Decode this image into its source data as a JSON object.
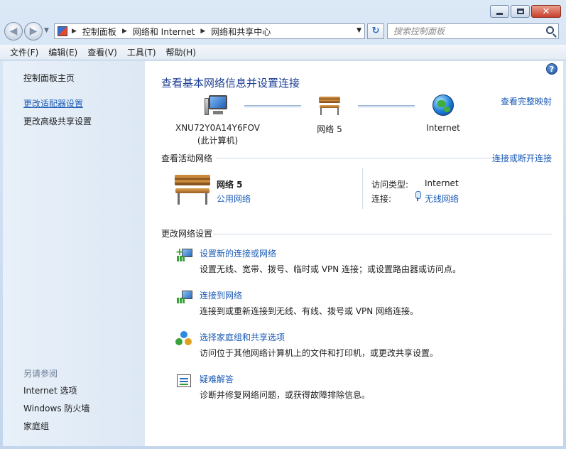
{
  "window": {
    "address": {
      "crumbs": [
        "控制面板",
        "网络和 Internet",
        "网络和共享中心"
      ]
    },
    "search": {
      "placeholder": "搜索控制面板"
    }
  },
  "menu": [
    "文件(F)",
    "编辑(E)",
    "查看(V)",
    "工具(T)",
    "帮助(H)"
  ],
  "sidebar": {
    "home": "控制面板主页",
    "links": [
      "更改适配器设置",
      "更改高级共享设置"
    ],
    "see_also_title": "另请参阅",
    "see_also": [
      "Internet 选项",
      "Windows 防火墙",
      "家庭组"
    ]
  },
  "main": {
    "title": "查看基本网络信息并设置连接",
    "view_full_map": "查看完整映射",
    "map": {
      "computer_name": "XNU72Y0A14Y6FOV",
      "computer_sub": "(此计算机)",
      "network": "网络  5",
      "internet": "Internet"
    },
    "active_section": "查看活动网络",
    "connect_disconnect": "连接或断开连接",
    "active": {
      "name": "网络  5",
      "type": "公用网络",
      "access_label": "访问类型:",
      "access_value": "Internet",
      "conn_label": "连接:",
      "conn_value": "无线网络"
    },
    "change_section": "更改网络设置",
    "tasks": [
      {
        "title": "设置新的连接或网络",
        "desc": "设置无线、宽带、拨号、临时或 VPN 连接；或设置路由器或访问点。"
      },
      {
        "title": "连接到网络",
        "desc": "连接到或重新连接到无线、有线、拨号或 VPN 网络连接。"
      },
      {
        "title": "选择家庭组和共享选项",
        "desc": "访问位于其他网络计算机上的文件和打印机，或更改共享设置。"
      },
      {
        "title": "疑难解答",
        "desc": "诊断并修复网络问题，或获得故障排除信息。"
      }
    ]
  },
  "colors": {
    "link": "#1a5ab5",
    "title": "#1c3f94",
    "sidebar_bg": "#e8f0f9",
    "close_button": "#c7402c"
  }
}
